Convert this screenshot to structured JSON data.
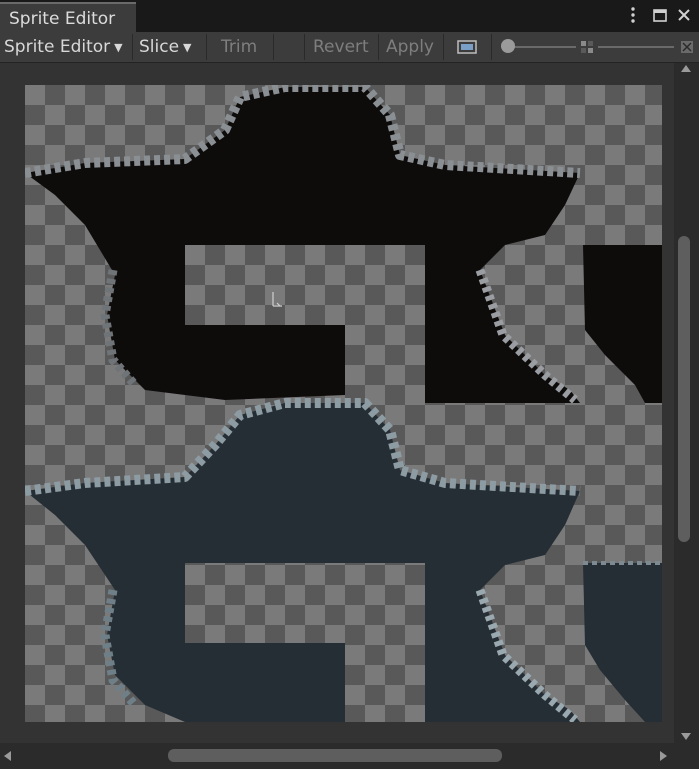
{
  "window": {
    "tab_title": "Sprite Editor",
    "menu_icon": "more-vertical-icon",
    "maximize_icon": "maximize-icon",
    "close_icon": "close-icon"
  },
  "toolbar": {
    "mode_label": "Sprite Editor",
    "slice_label": "Slice",
    "trim_label": "Trim",
    "revert_label": "Revert",
    "apply_label": "Apply",
    "channel_icon": "color-channel-icon",
    "zoom_icon": "zoom-icon",
    "mip_icon": "mip-level-icon"
  },
  "colors": {
    "panel": "#3c3c3c",
    "canvas_bg": "#333333",
    "checker_light": "#7a7a7a",
    "checker_dark": "#595959",
    "sprite_dark": "#0e0b0b",
    "sprite_blue": "#252e34",
    "rock_light": "#8a8f93"
  }
}
